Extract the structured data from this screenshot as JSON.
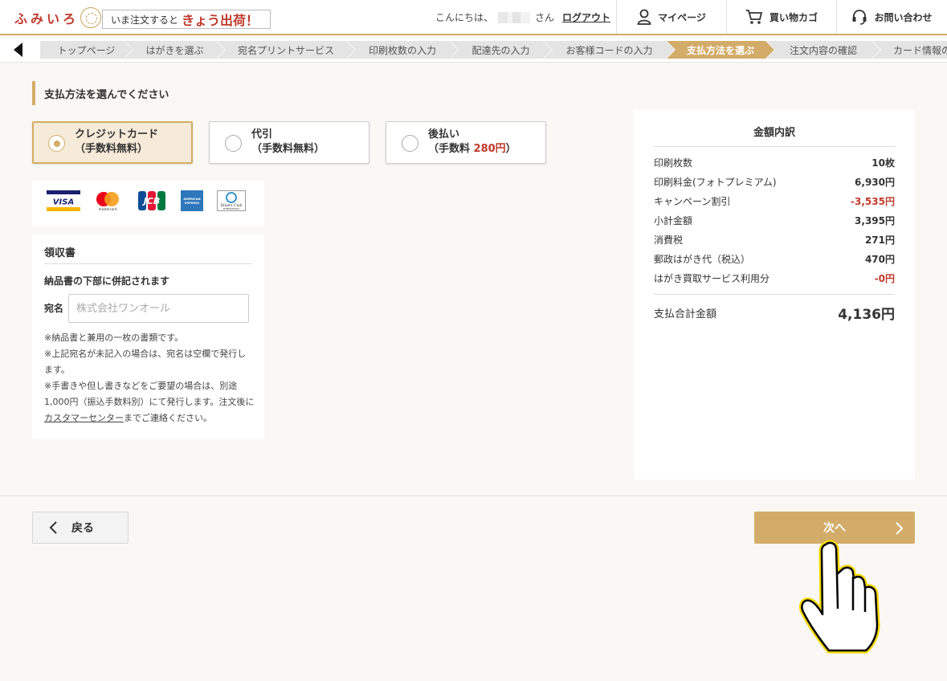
{
  "header": {
    "logo_text": "ふみいろ",
    "promo_prefix": "いま注文すると",
    "promo_main": "きょう出荷！",
    "greeting_prefix": "こんにちは、",
    "greeting_suffix": "さん",
    "logout": "ログアウト",
    "nav": [
      {
        "label": "マイページ",
        "icon": "person-icon"
      },
      {
        "label": "買い物カゴ",
        "icon": "cart-icon"
      },
      {
        "label": "お問い合わせ",
        "icon": "headset-icon"
      }
    ]
  },
  "breadcrumb": [
    "トップページ",
    "はがきを選ぶ",
    "宛名プリントサービス",
    "印刷枚数の入力",
    "配達先の入力",
    "お客様コードの入力",
    "支払方法を選ぶ",
    "注文内容の確認",
    "カード情報の"
  ],
  "breadcrumb_active_index": 6,
  "page": {
    "title": "支払方法を選んでください"
  },
  "payment_options": [
    {
      "name": "クレジットカード",
      "fee_prefix": "（手数料無料）",
      "fee_amount": "",
      "fee_suffix": "",
      "selected": true
    },
    {
      "name": "代引",
      "fee_prefix": "（手数料無料）",
      "fee_amount": "",
      "fee_suffix": "",
      "selected": false
    },
    {
      "name": "後払い",
      "fee_prefix": "（手数料 ",
      "fee_amount": "280円",
      "fee_suffix": "）",
      "selected": false
    }
  ],
  "card_logos": [
    "VISA",
    "mastercard",
    "JCB",
    "AMERICAN EXPRESS",
    "Diners Club INTERNATIONAL"
  ],
  "receipt": {
    "title": "領収書",
    "note": "納品書の下部に併記されます",
    "addressee_label": "宛名",
    "addressee_placeholder": "株式会社ワンオール",
    "notes_line1": "※納品書と兼用の一枚の書類です。",
    "notes_line2": "※上記宛名が未記入の場合は、宛名は空欄で発行します。",
    "notes_line3": "※手書きや但し書きなどをご要望の場合は、別途1,000円（振込手数料別）にて発行します。注文後に",
    "notes_link": "カスタマーセンター",
    "notes_line3_end": "までご連絡ください。"
  },
  "summary": {
    "title": "金額内訳",
    "rows": [
      {
        "label": "印刷枚数",
        "value": "10枚",
        "negative": false
      },
      {
        "label": "印刷料金(フォトプレミアム)",
        "value": "6,930円",
        "negative": false
      },
      {
        "label": "キャンペーン割引",
        "value": "-3,535円",
        "negative": true
      },
      {
        "label": "小計金額",
        "value": "3,395円",
        "negative": false
      },
      {
        "label": "消費税",
        "value": "271円",
        "negative": false
      },
      {
        "label": "郵政はがき代（税込）",
        "value": "470円",
        "negative": false
      },
      {
        "label": "はがき買取サービス利用分",
        "value": "-0円",
        "negative": true
      }
    ],
    "total_label": "支払合計金額",
    "total_value": "4,136円"
  },
  "buttons": {
    "back": "戻る",
    "next": "次へ"
  },
  "colors": {
    "accent": "#d3ac6a",
    "brand_red": "#c0392b",
    "background": "#f9f8f4"
  }
}
